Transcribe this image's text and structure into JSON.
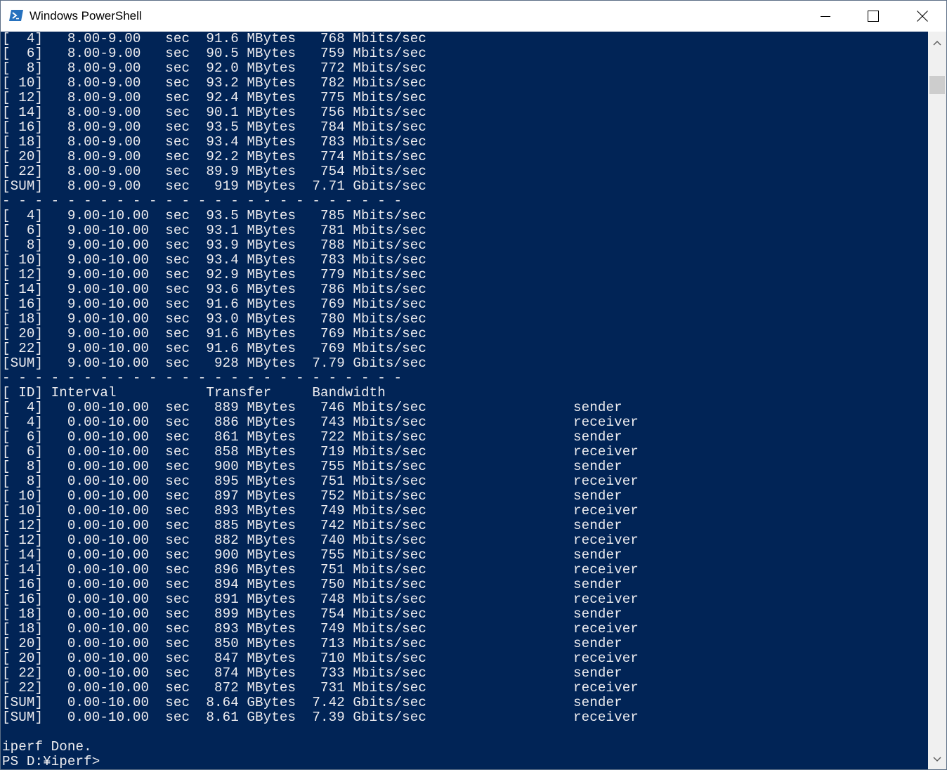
{
  "window": {
    "title": "Windows PowerShell"
  },
  "console": {
    "lines": [
      "[  4]   8.00-9.00   sec  91.6 MBytes   768 Mbits/sec",
      "[  6]   8.00-9.00   sec  90.5 MBytes   759 Mbits/sec",
      "[  8]   8.00-9.00   sec  92.0 MBytes   772 Mbits/sec",
      "[ 10]   8.00-9.00   sec  93.2 MBytes   782 Mbits/sec",
      "[ 12]   8.00-9.00   sec  92.4 MBytes   775 Mbits/sec",
      "[ 14]   8.00-9.00   sec  90.1 MBytes   756 Mbits/sec",
      "[ 16]   8.00-9.00   sec  93.5 MBytes   784 Mbits/sec",
      "[ 18]   8.00-9.00   sec  93.4 MBytes   783 Mbits/sec",
      "[ 20]   8.00-9.00   sec  92.2 MBytes   774 Mbits/sec",
      "[ 22]   8.00-9.00   sec  89.9 MBytes   754 Mbits/sec",
      "[SUM]   8.00-9.00   sec   919 MBytes  7.71 Gbits/sec",
      "- - - - - - - - - - - - - - - - - - - - - - - - -",
      "[  4]   9.00-10.00  sec  93.5 MBytes   785 Mbits/sec",
      "[  6]   9.00-10.00  sec  93.1 MBytes   781 Mbits/sec",
      "[  8]   9.00-10.00  sec  93.9 MBytes   788 Mbits/sec",
      "[ 10]   9.00-10.00  sec  93.4 MBytes   783 Mbits/sec",
      "[ 12]   9.00-10.00  sec  92.9 MBytes   779 Mbits/sec",
      "[ 14]   9.00-10.00  sec  93.6 MBytes   786 Mbits/sec",
      "[ 16]   9.00-10.00  sec  91.6 MBytes   769 Mbits/sec",
      "[ 18]   9.00-10.00  sec  93.0 MBytes   780 Mbits/sec",
      "[ 20]   9.00-10.00  sec  91.6 MBytes   769 Mbits/sec",
      "[ 22]   9.00-10.00  sec  91.6 MBytes   769 Mbits/sec",
      "[SUM]   9.00-10.00  sec   928 MBytes  7.79 Gbits/sec",
      "- - - - - - - - - - - - - - - - - - - - - - - - -",
      "[ ID] Interval           Transfer     Bandwidth",
      "[  4]   0.00-10.00  sec   889 MBytes   746 Mbits/sec                  sender",
      "[  4]   0.00-10.00  sec   886 MBytes   743 Mbits/sec                  receiver",
      "[  6]   0.00-10.00  sec   861 MBytes   722 Mbits/sec                  sender",
      "[  6]   0.00-10.00  sec   858 MBytes   719 Mbits/sec                  receiver",
      "[  8]   0.00-10.00  sec   900 MBytes   755 Mbits/sec                  sender",
      "[  8]   0.00-10.00  sec   895 MBytes   751 Mbits/sec                  receiver",
      "[ 10]   0.00-10.00  sec   897 MBytes   752 Mbits/sec                  sender",
      "[ 10]   0.00-10.00  sec   893 MBytes   749 Mbits/sec                  receiver",
      "[ 12]   0.00-10.00  sec   885 MBytes   742 Mbits/sec                  sender",
      "[ 12]   0.00-10.00  sec   882 MBytes   740 Mbits/sec                  receiver",
      "[ 14]   0.00-10.00  sec   900 MBytes   755 Mbits/sec                  sender",
      "[ 14]   0.00-10.00  sec   896 MBytes   751 Mbits/sec                  receiver",
      "[ 16]   0.00-10.00  sec   894 MBytes   750 Mbits/sec                  sender",
      "[ 16]   0.00-10.00  sec   891 MBytes   748 Mbits/sec                  receiver",
      "[ 18]   0.00-10.00  sec   899 MBytes   754 Mbits/sec                  sender",
      "[ 18]   0.00-10.00  sec   893 MBytes   749 Mbits/sec                  receiver",
      "[ 20]   0.00-10.00  sec   850 MBytes   713 Mbits/sec                  sender",
      "[ 20]   0.00-10.00  sec   847 MBytes   710 Mbits/sec                  receiver",
      "[ 22]   0.00-10.00  sec   874 MBytes   733 Mbits/sec                  sender",
      "[ 22]   0.00-10.00  sec   872 MBytes   731 Mbits/sec                  receiver",
      "[SUM]   0.00-10.00  sec  8.64 GBytes  7.42 Gbits/sec                  sender",
      "[SUM]   0.00-10.00  sec  8.61 GBytes  7.39 Gbits/sec                  receiver",
      "",
      "iperf Done.",
      "PS D:¥iperf>"
    ]
  },
  "icons": {
    "app": "powershell-icon",
    "minimize": "minimize-icon",
    "maximize": "maximize-icon",
    "close": "close-icon",
    "scroll_up": "chevron-up-icon",
    "scroll_down": "chevron-down-icon"
  },
  "colors": {
    "console_background": "#012456",
    "console_text": "#eeedf0",
    "titlebar_background": "#ffffff",
    "scrollbar_track": "#f0f0f0",
    "scrollbar_thumb": "#cdcdcd"
  }
}
